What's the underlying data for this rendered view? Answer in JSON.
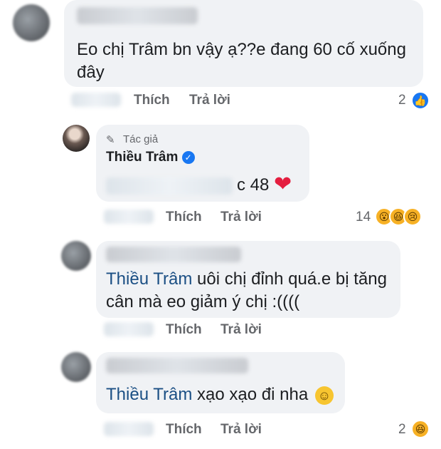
{
  "comments": [
    {
      "text": "Eo chị Trâm bn vậy ạ??e đang 60 cố xuống đây",
      "like_label": "Thích",
      "reply_label": "Trả lời",
      "reaction_count": "2",
      "reactions": [
        "like-icon"
      ]
    },
    {
      "author_badge": "Tác giả",
      "author_name": "Thiều Trâm",
      "text": "c 48",
      "like_label": "Thích",
      "reply_label": "Trả lời",
      "reaction_count": "14",
      "reactions": [
        "wow-icon",
        "haha-icon",
        "sad-icon"
      ]
    },
    {
      "mention": "Thiều Trâm",
      "text": "uôi chị đỉnh quá.e bị tăng cân mà eo giảm ý chị :((((",
      "like_label": "Thích",
      "reply_label": "Trả lời"
    },
    {
      "mention": "Thiều Trâm",
      "text": "xạo xạo đi nha",
      "like_label": "Thích",
      "reply_label": "Trả lời",
      "reaction_count": "2",
      "reactions": [
        "haha-icon"
      ]
    }
  ],
  "colors": {
    "bubble": "#f0f2f5",
    "mention": "#1b4f84",
    "action": "#65676b",
    "like": "#1877f2",
    "heart": "#e41e3f"
  }
}
